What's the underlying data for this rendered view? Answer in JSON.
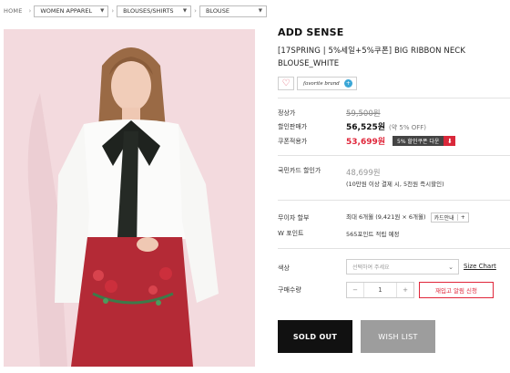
{
  "breadcrumb": {
    "home": "HOME",
    "level1": "WOMEN APPAREL",
    "level2": "BLOUSES/SHIRTS",
    "level3": "BLOUSE"
  },
  "product": {
    "brand": "ADD SENSE",
    "name": "[17SPRING | 5%세일+5%쿠폰] BIG RIBBON NECK BLOUSE_WHITE",
    "favorite_label": "favorite brand"
  },
  "pricing": {
    "normal_label": "정상가",
    "normal_value": "59,500원",
    "sale_label": "할인판매가",
    "sale_value": "56,525원",
    "sale_off": "(약 5% OFF)",
    "coupon_label": "쿠폰적용가",
    "coupon_value": "53,699원",
    "coupon_button": "5% 할인쿠폰 다운"
  },
  "card": {
    "label": "국민카드 할인가",
    "price": "48,699원",
    "note": "(10만원 이상 결제 시, 5천원 즉시할인)"
  },
  "installment": {
    "label": "무이자 할부",
    "text": "최대 6개월 (9,421원 × 6개월)",
    "button": "카드안내",
    "plus": "+"
  },
  "points": {
    "label": "W 포인트",
    "text": "565포인트 적립 예정"
  },
  "options": {
    "color_label": "색상",
    "color_placeholder": "선택하여 주세요",
    "size_chart": "Size Chart",
    "qty_label": "구매수량",
    "qty_minus": "−",
    "qty_value": "1",
    "qty_plus": "+",
    "restock_button": "재입고 알림 신청"
  },
  "actions": {
    "sold_out": "SOLD OUT",
    "wish_list": "WISH LIST"
  },
  "colors": {
    "accent_red": "#e0263a",
    "dark_button": "#111111",
    "grey_button": "#9d9d9d"
  }
}
